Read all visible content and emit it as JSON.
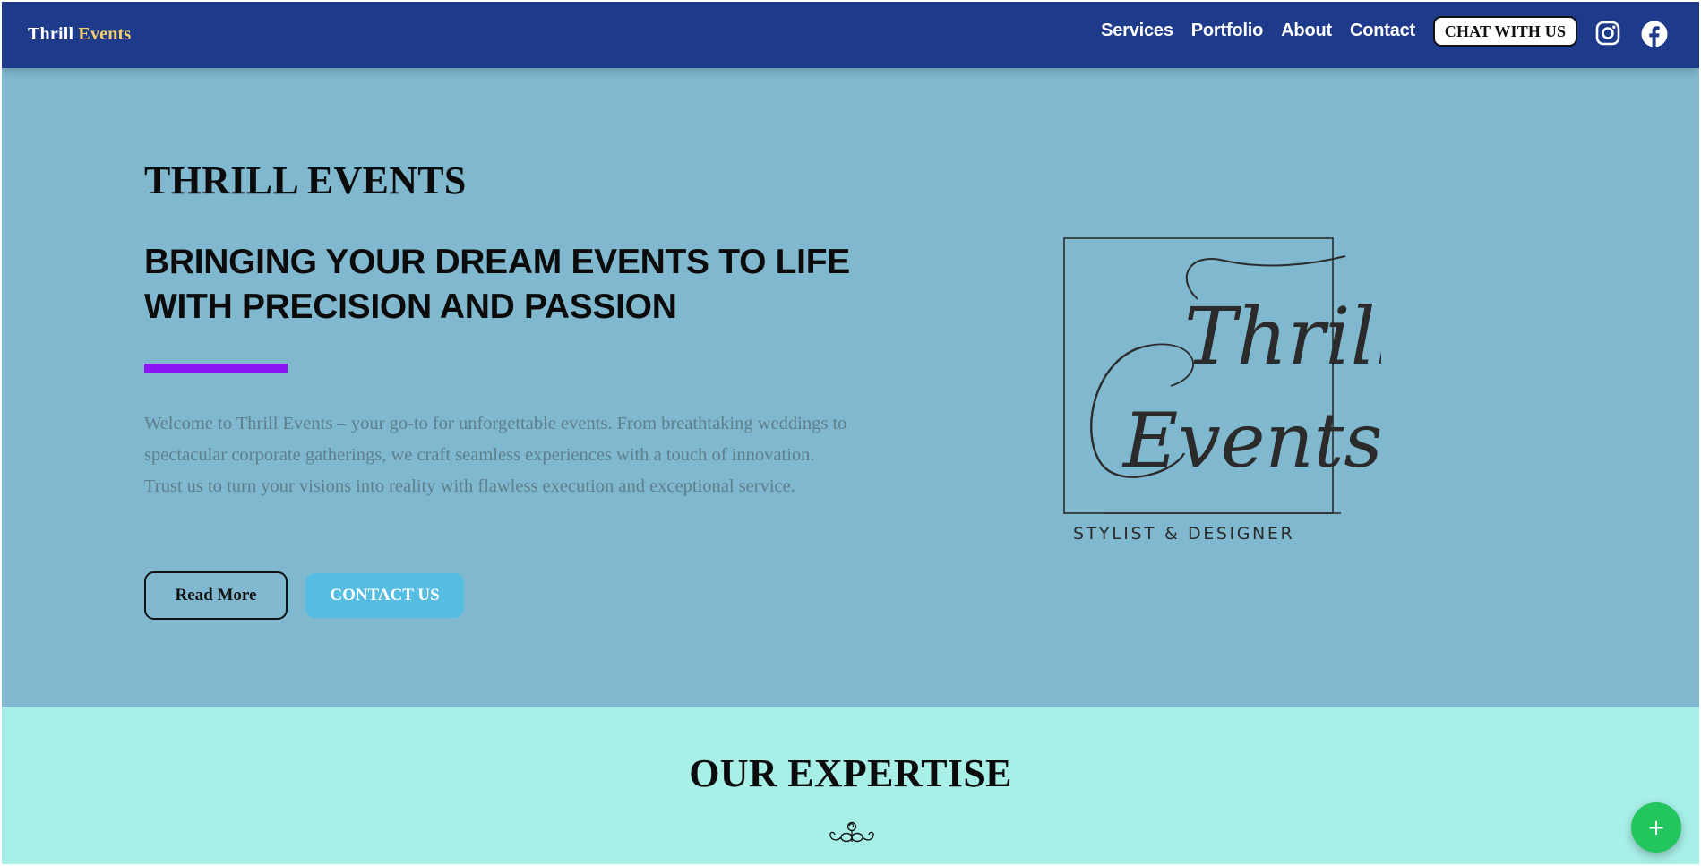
{
  "header": {
    "logo_first": "Thrill",
    "logo_second": "Events",
    "nav": [
      {
        "label": "Services"
      },
      {
        "label": "Portfolio"
      },
      {
        "label": "About"
      },
      {
        "label": "Contact"
      }
    ],
    "chat_button": "CHAT WITH US",
    "social_icons": [
      "instagram-icon",
      "facebook-icon"
    ]
  },
  "hero": {
    "title": "THRILL EVENTS",
    "subtitle": "BRINGING YOUR DREAM EVENTS TO LIFE WITH PRECISION AND PASSION",
    "description": "Welcome to Thrill Events – your go-to for unforgettable events. From breathtaking weddings to spectacular corporate gatherings, we craft seamless experiences with a touch of innovation. Trust us to turn your visions into reality with flawless execution and exceptional service.",
    "read_more": "Read More",
    "contact_us": "CONTACT US",
    "brand_logo": {
      "script_line1": "Thrill",
      "script_line2": "Events",
      "tagline": "STYLIST & DESIGNER"
    }
  },
  "expertise": {
    "title": "OUR EXPERTISE",
    "ornament_icon": "flourish-ornament-icon"
  },
  "fab": {
    "label": "+",
    "icon": "plus-icon"
  },
  "colors": {
    "header_bg": "#1e3a8a",
    "logo_accent": "#f5cf6b",
    "hero_bg": "#80b9cf",
    "accent_bar": "#8a16f5",
    "contact_btn": "#55bde2",
    "expertise_bg": "#a7efe7",
    "fab_bg": "#22c55e"
  }
}
